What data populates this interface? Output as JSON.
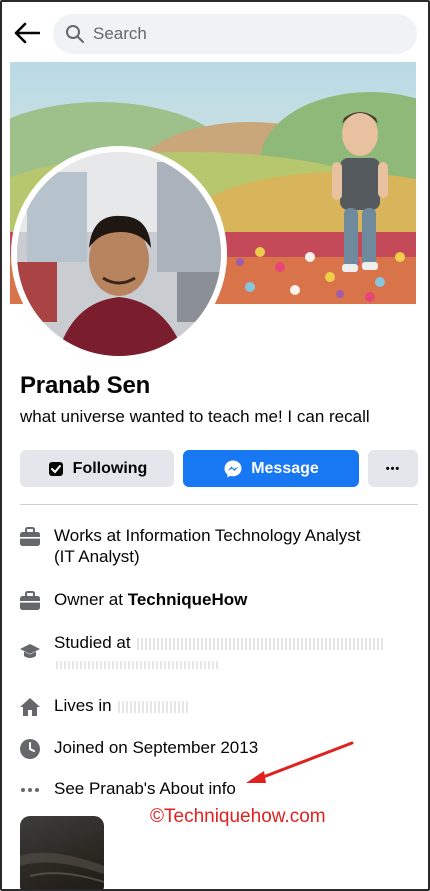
{
  "header": {
    "search_placeholder": "Search"
  },
  "profile": {
    "name": "Pranab Sen",
    "bio": "what universe wanted to teach me! I can recall"
  },
  "actions": {
    "following_label": "Following",
    "message_label": "Message",
    "more_label": "•••"
  },
  "about": {
    "work_line1": "Works at Information Technology Analyst",
    "work_line2": "(IT Analyst)",
    "owner_prefix": "Owner at ",
    "owner_company": "TechniqueHow",
    "studied_prefix": "Studied at ",
    "lives_prefix": "Lives in ",
    "joined": "Joined on September 2013",
    "see_about": "See Pranab's About info"
  },
  "watermark": "©Techniquehow.com",
  "colors": {
    "accent": "#1877f2",
    "button_gray": "#e4e6eb",
    "annotation_red": "#e0211f"
  }
}
